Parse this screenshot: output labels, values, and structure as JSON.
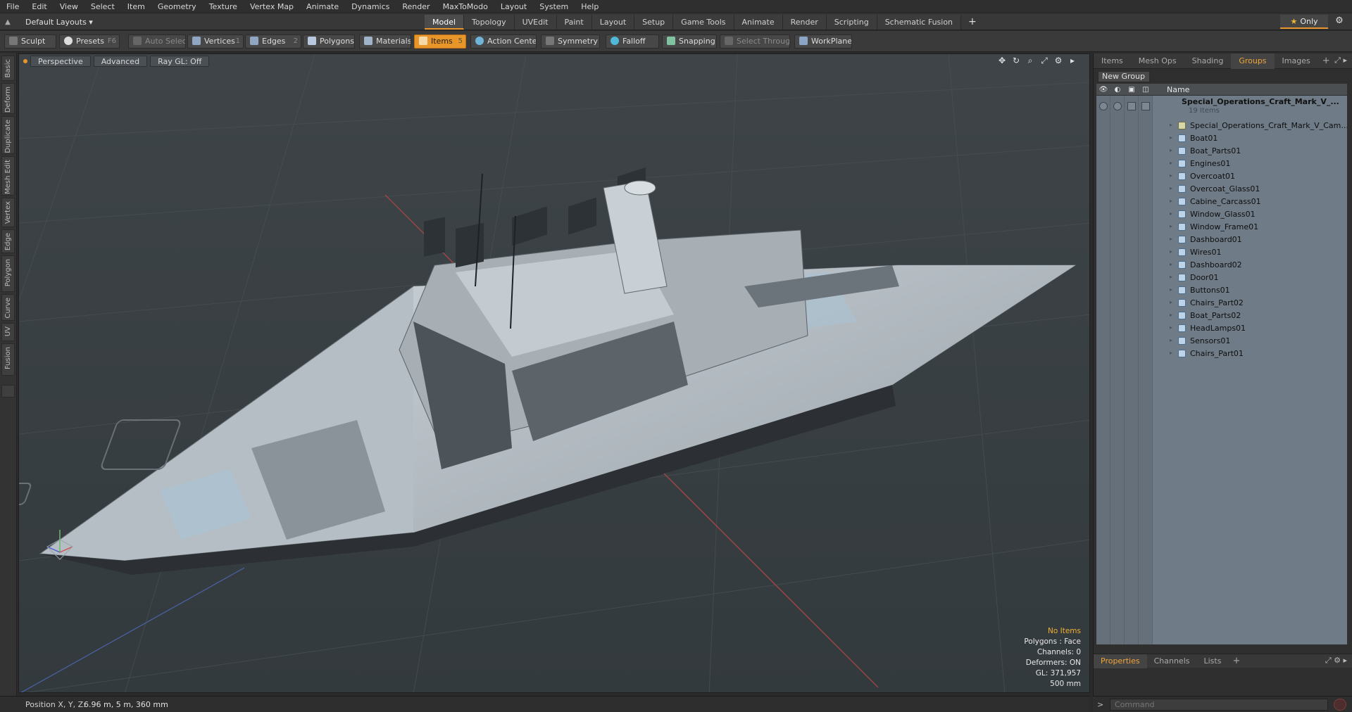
{
  "menu": [
    "File",
    "Edit",
    "View",
    "Select",
    "Item",
    "Geometry",
    "Texture",
    "Vertex Map",
    "Animate",
    "Dynamics",
    "Render",
    "MaxToModo",
    "Layout",
    "System",
    "Help"
  ],
  "layout_selector": "Default Layouts ▾",
  "mode_tabs": [
    "Model",
    "Topology",
    "UVEdit",
    "Paint",
    "Layout",
    "Setup",
    "Game Tools",
    "Animate",
    "Render",
    "Scripting",
    "Schematic Fusion"
  ],
  "active_mode_tab": "Model",
  "only_label": "Only",
  "toolbar": {
    "sculpt": "Sculpt",
    "presets": "Presets",
    "presets_key": "F6",
    "auto_select": "Auto Select",
    "vertices": "Vertices",
    "vertices_key": "1",
    "edges": "Edges",
    "edges_key": "2",
    "polygons": "Polygons",
    "materials": "Materials",
    "items": "Items",
    "items_key": "5",
    "action_center": "Action Center",
    "symmetry": "Symmetry",
    "falloff": "Falloff",
    "snapping": "Snapping",
    "select_through": "Select Through",
    "workplane": "WorkPlane"
  },
  "left_tabs": [
    "Basic",
    "Deform",
    "Duplicate",
    "Mesh Edit",
    "Vertex",
    "Edge",
    "Polygon",
    "Curve",
    "UV",
    "Fusion"
  ],
  "viewport": {
    "view": "Perspective",
    "shading": "Advanced",
    "raygl": "Ray GL: Off",
    "info": {
      "selection": "No Items",
      "polygons": "Polygons : Face",
      "channels": "Channels: 0",
      "deformers": "Deformers: ON",
      "gl": "GL: 371,957",
      "grid": "500 mm"
    }
  },
  "right_panel": {
    "tabs": [
      "Items",
      "Mesh Ops",
      "Shading",
      "Groups",
      "Images"
    ],
    "active_tab": "Groups",
    "new_group": "New Group",
    "name_header": "Name",
    "group_name": "Special_Operations_Craft_Mark_V_...",
    "group_count": "19 Items",
    "items": [
      {
        "label": "Special_Operations_Craft_Mark_V_Cam...",
        "type": "camera"
      },
      {
        "label": "Boat01",
        "type": "mesh"
      },
      {
        "label": "Boat_Parts01",
        "type": "mesh"
      },
      {
        "label": "Engines01",
        "type": "mesh"
      },
      {
        "label": "Overcoat01",
        "type": "mesh"
      },
      {
        "label": "Overcoat_Glass01",
        "type": "mesh"
      },
      {
        "label": "Cabine_Carcass01",
        "type": "mesh"
      },
      {
        "label": "Window_Glass01",
        "type": "mesh"
      },
      {
        "label": "Window_Frame01",
        "type": "mesh"
      },
      {
        "label": "Dashboard01",
        "type": "mesh"
      },
      {
        "label": "Wires01",
        "type": "mesh"
      },
      {
        "label": "Dashboard02",
        "type": "mesh"
      },
      {
        "label": "Door01",
        "type": "mesh"
      },
      {
        "label": "Buttons01",
        "type": "mesh"
      },
      {
        "label": "Chairs_Part02",
        "type": "mesh"
      },
      {
        "label": "Boat_Parts02",
        "type": "mesh"
      },
      {
        "label": "HeadLamps01",
        "type": "mesh"
      },
      {
        "label": "Sensors01",
        "type": "mesh"
      },
      {
        "label": "Chairs_Part01",
        "type": "mesh"
      }
    ]
  },
  "properties_tabs": [
    "Properties",
    "Channels",
    "Lists"
  ],
  "active_properties_tab": "Properties",
  "status": {
    "position_label": "Position X, Y, Z:",
    "position_value": "6.96 m, 5 m, 360 mm"
  },
  "command": {
    "placeholder": "Command"
  },
  "colors": {
    "accent": "#e8952a",
    "viewport_bg": "#3a4044",
    "list_bg": "#6f7b86"
  }
}
